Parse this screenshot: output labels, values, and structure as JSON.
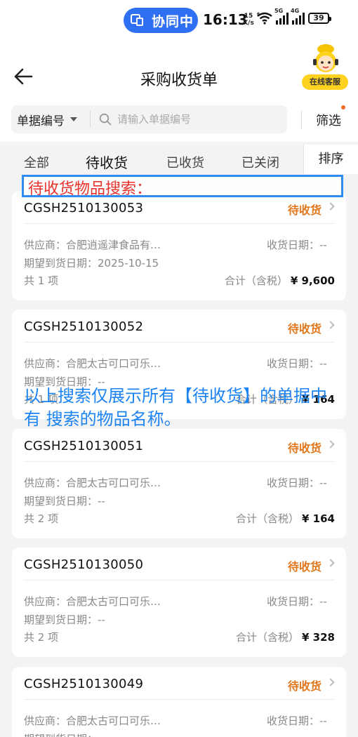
{
  "status_bar": {
    "collab_label": "协同中",
    "time": "16:13",
    "speed": "15",
    "speed_unit": "K/s",
    "signal1_tag": "5G",
    "signal2_tag": "4G",
    "wifi_tag": "6",
    "battery": "39"
  },
  "header": {
    "title": "采购收货单",
    "service_label": "在线客服"
  },
  "search": {
    "field_label": "单据编号",
    "placeholder": "请输入单据编号",
    "filter_label": "筛选"
  },
  "tabs": [
    {
      "label": "全部"
    },
    {
      "label": "待收货"
    },
    {
      "label": "已收货"
    },
    {
      "label": "已关闭"
    }
  ],
  "sort_label": "排序",
  "annotations": {
    "search_title": "待收货物品搜索：",
    "note": "以上搜索仅展示所有【待收货】的单据中有 搜索的物品名称。"
  },
  "colors": {
    "accent": "#2f6ff2",
    "status_orange": "#e1771c",
    "annotation_red": "#e8332c",
    "annotation_blue": "#1c83f2"
  },
  "orders": [
    {
      "number": "CGSH2510130053",
      "status": "待收货",
      "supplier": "供应商：合肥逍遥津食品有…",
      "receive_date": "收货日期：--",
      "expected": "期望到货日期：2025-10-15",
      "count": "共 1 项",
      "total_label": "合计（含税）",
      "total": "¥ 9,600"
    },
    {
      "number": "CGSH2510130052",
      "status": "待收货",
      "supplier": "供应商：合肥太古可口可乐…",
      "receive_date": "收货日期：--",
      "expected": "期望到货日期：--",
      "count": "共 1 项",
      "total_label": "合计（含税）",
      "total": "¥ 164"
    },
    {
      "number": "CGSH2510130051",
      "status": "待收货",
      "supplier": "供应商：合肥太古可口可乐…",
      "receive_date": "收货日期：--",
      "expected": "期望到货日期：--",
      "count": "共 2 项",
      "total_label": "合计（含税）",
      "total": "¥ 164"
    },
    {
      "number": "CGSH2510130050",
      "status": "待收货",
      "supplier": "供应商：合肥太古可口可乐…",
      "receive_date": "收货日期：--",
      "expected": "期望到货日期：--",
      "count": "共 2 项",
      "total_label": "合计（含税）",
      "total": "¥ 328"
    },
    {
      "number": "CGSH2510130049",
      "status": "待收货",
      "supplier": "供应商：合肥太古可口可乐…",
      "receive_date": "收货日期：--",
      "expected": "期望到货日期：--",
      "count": "",
      "total_label": "",
      "total": ""
    }
  ]
}
